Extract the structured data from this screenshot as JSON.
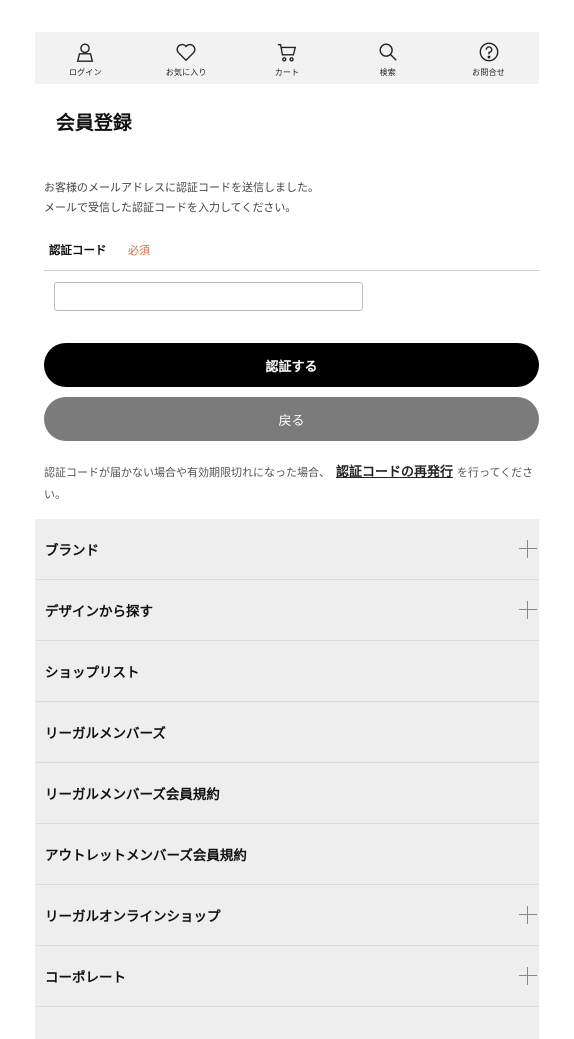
{
  "nav": {
    "items": [
      {
        "label": "ログイン",
        "icon": "user-icon"
      },
      {
        "label": "お気に入り",
        "icon": "heart-icon"
      },
      {
        "label": "カート",
        "icon": "cart-icon"
      },
      {
        "label": "検索",
        "icon": "search-icon"
      },
      {
        "label": "お問合せ",
        "icon": "question-icon"
      }
    ]
  },
  "page": {
    "title": "会員登録",
    "info_line1": "お客様のメールアドレスに認証コードを送信しました。",
    "info_line2": "メールで受信した認証コードを入力してください。",
    "code_label": "認証コード",
    "required": "必須",
    "code_value": "",
    "submit_label": "認証する",
    "back_label": "戻る",
    "note_before": "認証コードが届かない場合や有効期限切れになった場合、",
    "note_link": "認証コードの再発行",
    "note_after": "を行ってください。"
  },
  "menu": {
    "items": [
      {
        "label": "ブランド",
        "expandable": true
      },
      {
        "label": "デザインから探す",
        "expandable": true
      },
      {
        "label": "ショップリスト",
        "expandable": false
      },
      {
        "label": "リーガルメンバーズ",
        "expandable": false
      },
      {
        "label": "リーガルメンバーズ会員規約",
        "expandable": false
      },
      {
        "label": "アウトレットメンバーズ会員規約",
        "expandable": false
      },
      {
        "label": "リーガルオンラインショップ",
        "expandable": true
      },
      {
        "label": "コーポレート",
        "expandable": true
      }
    ]
  },
  "colors": {
    "required": "#d06a4a",
    "primary_button": "#000000",
    "back_button": "#7b7b7b",
    "menu_bg": "#eeeeee"
  }
}
